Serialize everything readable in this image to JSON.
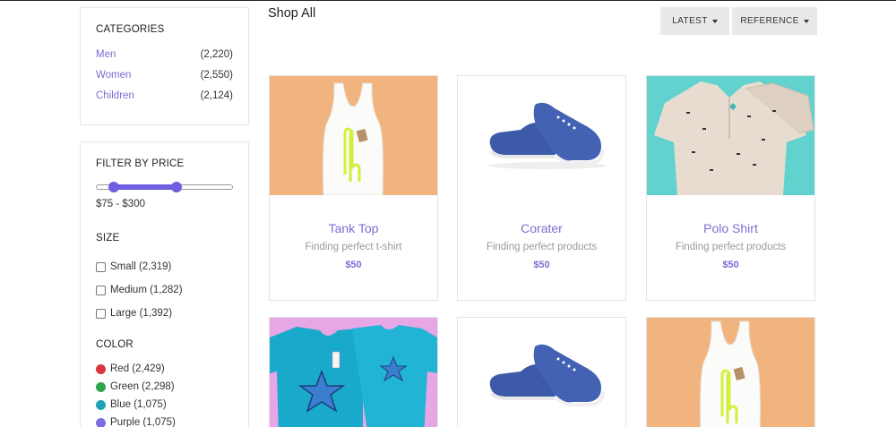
{
  "categories": {
    "title": "CATEGORIES",
    "items": [
      {
        "name": "Men",
        "count": "(2,220)"
      },
      {
        "name": "Women",
        "count": "(2,550)"
      },
      {
        "name": "Children",
        "count": "(2,124)"
      }
    ]
  },
  "price_filter": {
    "title": "FILTER BY PRICE",
    "range_text": "$75 - $300",
    "range_low_fraction": 0.13,
    "range_high_fraction": 0.59
  },
  "size": {
    "title": "SIZE",
    "items": [
      {
        "label": "Small (2,319)"
      },
      {
        "label": "Medium (1,282)"
      },
      {
        "label": "Large (1,392)"
      }
    ]
  },
  "color": {
    "title": "COLOR",
    "items": [
      {
        "label": "Red (2,429)",
        "hex": "#d9363e"
      },
      {
        "label": "Green (2,298)",
        "hex": "#2ea44f"
      },
      {
        "label": "Blue (1,075)",
        "hex": "#1fa2b3"
      },
      {
        "label": "Purple (1,075)",
        "hex": "#7a6fe0"
      }
    ]
  },
  "header": {
    "title": "Shop All",
    "sort_latest": "LATEST",
    "sort_reference": "REFERENCE"
  },
  "products": [
    {
      "name": "Tank Top",
      "desc": "Finding perfect t-shirt",
      "price": "$50",
      "image": "tank-top-image",
      "bg": "#f2b47e"
    },
    {
      "name": "Corater",
      "desc": "Finding perfect products",
      "price": "$50",
      "image": "sneaker-image",
      "bg": "#ffffff"
    },
    {
      "name": "Polo Shirt",
      "desc": "Finding perfect products",
      "price": "$50",
      "image": "polo-shirt-image",
      "bg": "#62d2cf"
    },
    {
      "name": "",
      "desc": "",
      "price": "",
      "image": "blue-tshirt-image",
      "bg": "#e7a6e6"
    },
    {
      "name": "",
      "desc": "",
      "price": "",
      "image": "sneaker-image",
      "bg": "#ffffff"
    },
    {
      "name": "",
      "desc": "",
      "price": "",
      "image": "tank-top-image",
      "bg": "#f2b47e"
    }
  ],
  "colors": {
    "accent": "#7a6fd1",
    "slider": "#6d5fe0"
  }
}
